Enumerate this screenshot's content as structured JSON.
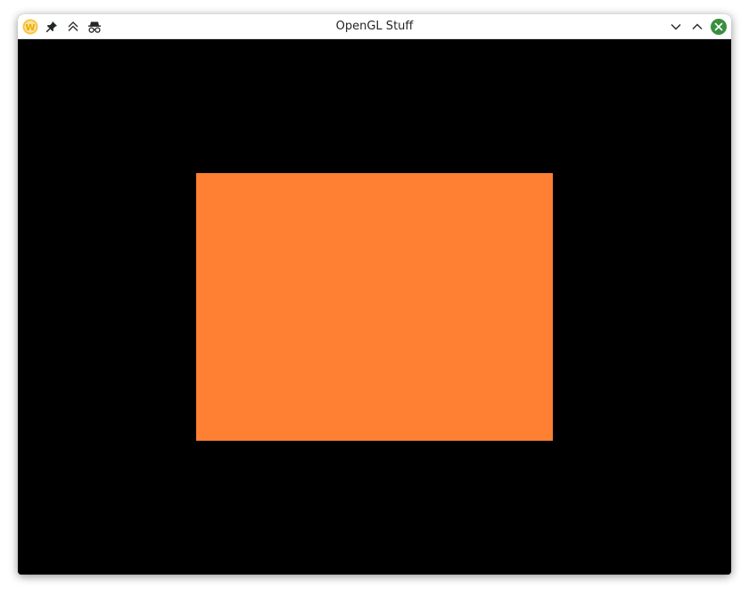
{
  "window": {
    "title": "OpenGL Stuff"
  },
  "titlebar_icons": {
    "app": "app-logo-icon",
    "pin": "pin-icon",
    "keep_above": "keep-above-icon",
    "incognito": "incognito-icon",
    "minimize": "minimize-icon",
    "maximize": "maximize-icon",
    "close": "close-icon"
  },
  "colors": {
    "canvas_background": "#000000",
    "rectangle_fill": "#ff7f33",
    "close_button": "#3a8f3f",
    "app_logo": "#f5c542"
  }
}
